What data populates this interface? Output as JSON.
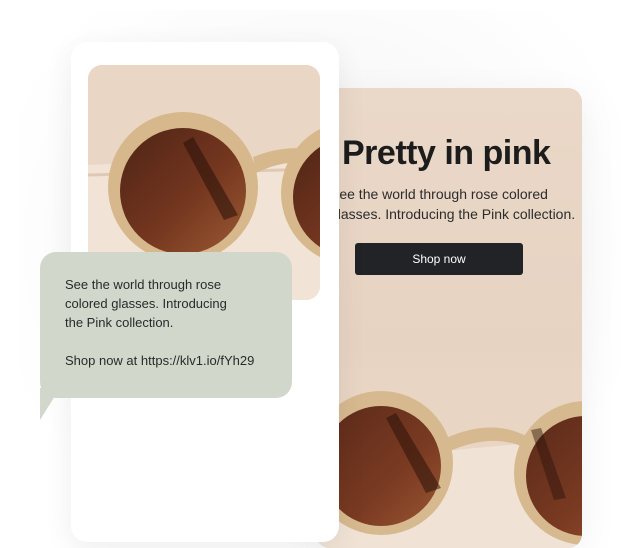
{
  "email": {
    "headline": "Pretty in pink",
    "body": "See the world through rose colored\nglasses. Introducing the Pink collection.",
    "button_label": "Shop now"
  },
  "sms": {
    "line1": "See the world through rose",
    "line2": "colored glasses. Introducing",
    "line3": "the Pink collection.",
    "link_text": "Shop now at https://klv1.io/fYh29"
  },
  "colors": {
    "sms_bubble": "#d1d8cb",
    "email_background": "#ead8c8",
    "button": "#222326"
  },
  "icons": {
    "product": "sunglasses-photo"
  }
}
